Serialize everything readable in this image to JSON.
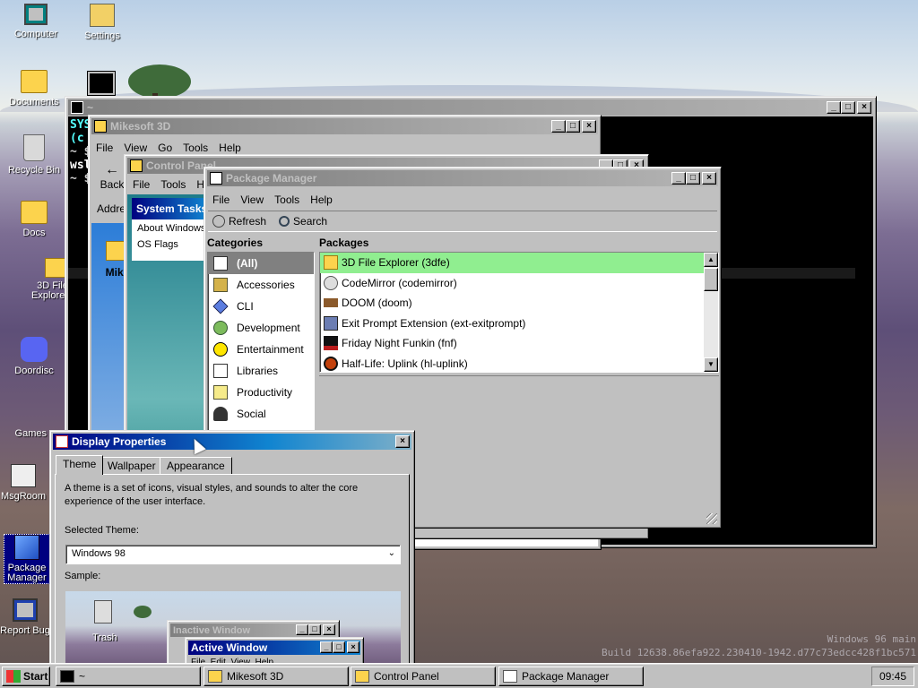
{
  "desktop": {
    "icons": [
      {
        "label": "Computer",
        "icon": "computer-icon"
      },
      {
        "label": "Settings",
        "icon": "settings-icon"
      },
      {
        "label": "Documents",
        "icon": "folder-icon"
      },
      {
        "label": "Recycle Bin",
        "icon": "recycle-bin-icon"
      },
      {
        "label": "Docs",
        "icon": "folder-icon"
      },
      {
        "label": "3D File Explorer",
        "icon": "folder-icon"
      },
      {
        "label": "Doordisc",
        "icon": "doordisc-icon"
      },
      {
        "label": "Games",
        "icon": "game-icon"
      },
      {
        "label": "MsgRoom",
        "icon": "msgroom-icon"
      },
      {
        "label": "Package Manager",
        "icon": "package-icon"
      },
      {
        "label": "Report Bug",
        "icon": "report-icon"
      }
    ],
    "watermark_line1": "Windows 96 main",
    "watermark_line2": "Build 12638.86efa922.230410-1942.d77c73edcc428f1bc571"
  },
  "terminal": {
    "title": "~",
    "lines": [
      "SYS",
      "(c",
      "~ $",
      "wsl",
      "~ $"
    ]
  },
  "explorer3d": {
    "title": "Mikesoft 3D",
    "menu": [
      "File",
      "View",
      "Go",
      "Tools",
      "Help"
    ],
    "back": "Back",
    "address": "Address",
    "folder_label": "Mike"
  },
  "control_panel": {
    "title": "Control Panel",
    "menu": [
      "File",
      "Tools",
      "Help"
    ],
    "system_tasks": "System Tasks",
    "items": [
      "About Windows",
      "OS Flags"
    ]
  },
  "package_manager": {
    "title": "Package Manager",
    "menu": [
      "File",
      "View",
      "Tools",
      "Help"
    ],
    "refresh": "Refresh",
    "search": "Search",
    "categories_header": "Categories",
    "packages_header": "Packages",
    "categories": [
      {
        "label": "(All)",
        "icon": "all-icon"
      },
      {
        "label": "Accessories",
        "icon": "accessories-icon"
      },
      {
        "label": "CLI",
        "icon": "cli-icon"
      },
      {
        "label": "Development",
        "icon": "development-icon"
      },
      {
        "label": "Entertainment",
        "icon": "entertainment-icon"
      },
      {
        "label": "Libraries",
        "icon": "libraries-icon"
      },
      {
        "label": "Productivity",
        "icon": "productivity-icon"
      },
      {
        "label": "Social",
        "icon": "social-icon"
      }
    ],
    "packages": [
      {
        "label": "3D File Explorer (3dfe)",
        "icon": "folder-icon",
        "color": "#fcd34d"
      },
      {
        "label": "CodeMirror (codemirror)",
        "icon": "codemirror-icon",
        "color": "#9ca3af"
      },
      {
        "label": "DOOM (doom)",
        "icon": "doom-icon",
        "color": "#8b5a2b"
      },
      {
        "label": "Exit Prompt Extension (ext-exitprompt)",
        "icon": "exit-prompt-icon",
        "color": "#6b7db3"
      },
      {
        "label": "Friday Night Funkin (fnf)",
        "icon": "fnf-icon",
        "color": "#b91c1c"
      },
      {
        "label": "Half-Life: Uplink (hl-uplink)",
        "icon": "half-life-icon",
        "color": "#c2410c"
      }
    ],
    "selected_color": "#90ee90"
  },
  "display_properties": {
    "title": "Display Properties",
    "tabs": [
      "Theme",
      "Wallpaper",
      "Appearance"
    ],
    "description": "A theme is a set of icons, visual styles, and sounds to alter the core experience of the user interface.",
    "selected_theme_label": "Selected Theme:",
    "selected_theme": "Windows 98",
    "sample_label": "Sample:",
    "sample": {
      "trash": "Trash",
      "inactive": "Inactive Window",
      "active": "Active Window",
      "menu_hint": "File  Edit  View  Help"
    }
  },
  "taskbar": {
    "start": "Start",
    "tasks": [
      {
        "label": "~",
        "icon": "terminal-icon"
      },
      {
        "label": "Mikesoft 3D",
        "icon": "folder-icon"
      },
      {
        "label": "Control Panel",
        "icon": "control-panel-icon"
      },
      {
        "label": "Package Manager",
        "icon": "package-icon"
      }
    ],
    "clock": "09:45"
  }
}
